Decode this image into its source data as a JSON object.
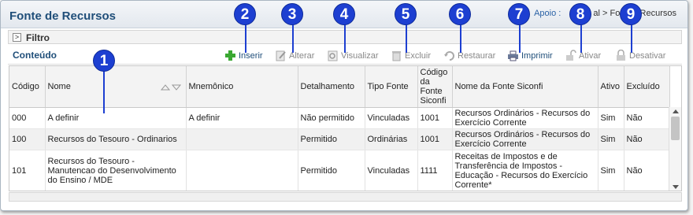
{
  "page": {
    "title": "Fonte de Recursos",
    "breadcrumb": {
      "part1": "Apoio",
      "part2": ":",
      "part3": "al > Fon",
      "part4": "Recursos"
    }
  },
  "filtro": {
    "label": "Filtro",
    "toggle": ">"
  },
  "conteudo": {
    "label": "Conteúdo"
  },
  "toolbar": {
    "inserir": "Inserir",
    "alterar": "Alterar",
    "visualizar": "Visualizar",
    "excluir": "Excluir",
    "restaurar": "Restaurar",
    "imprimir": "Imprimir",
    "ativar": "Ativar",
    "desativar": "Desativar"
  },
  "callouts": [
    "1",
    "2",
    "3",
    "4",
    "5",
    "6",
    "7",
    "8",
    "9"
  ],
  "table": {
    "columns": [
      "Código",
      "Nome",
      "Mnemônico",
      "Detalhamento",
      "Tipo Fonte",
      "Código da Fonte Siconfi",
      "Nome da Fonte Siconfi",
      "Ativo",
      "Excluído"
    ],
    "rows": [
      [
        "000",
        "A definir",
        "A definir",
        "Não permitido",
        "Vinculadas",
        "1001",
        "Recursos Ordinários - Recursos do Exercício Corrente",
        "Sim",
        "Não"
      ],
      [
        "100",
        "Recursos do Tesouro - Ordinarios",
        "",
        "Permitido",
        "Ordinárias",
        "1001",
        "Recursos Ordinários - Recursos do Exercício Corrente",
        "Sim",
        "Não"
      ],
      [
        "101",
        "Recursos do Tesouro - Manutencao do Desenvolvimento do Ensino / MDE",
        "",
        "Permitido",
        "Vinculadas",
        "1111",
        "Receitas de Impostos e de Transferência de Impostos - Educação - Recursos do Exercício Corrente*",
        "Sim",
        "Não"
      ]
    ]
  },
  "colors": {
    "accent": "#1f4e79",
    "callout": "#1d3fd1",
    "green": "#3aa832"
  },
  "icons": [
    "plus-icon",
    "edit-icon",
    "view-icon",
    "trash-icon",
    "restore-icon",
    "printer-icon",
    "unlock-icon",
    "lock-icon",
    "sort-icon"
  ]
}
